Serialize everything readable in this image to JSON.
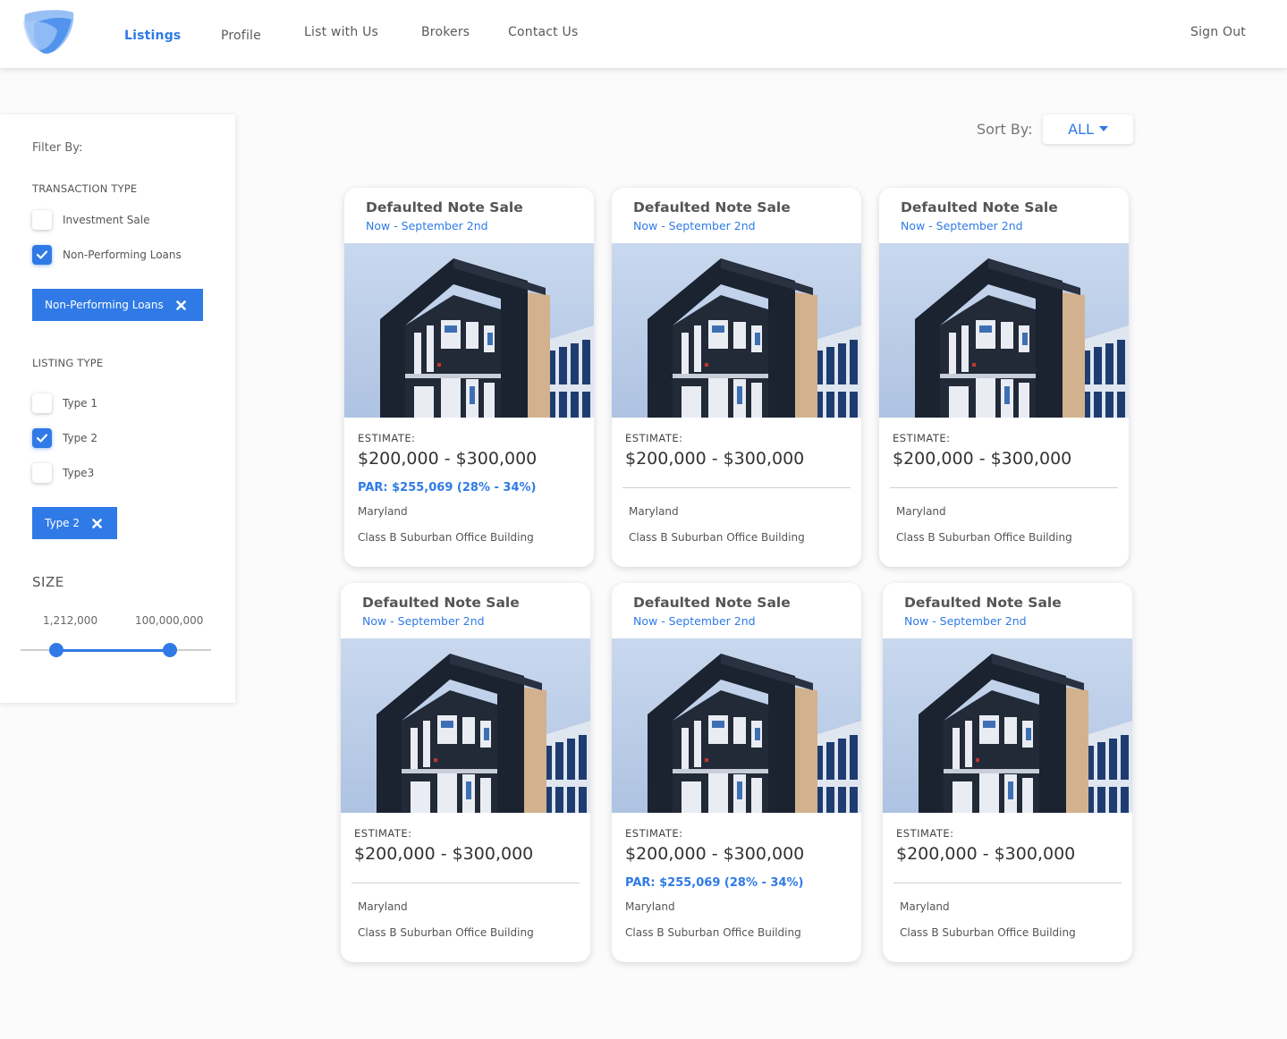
{
  "header": {
    "nav": {
      "listings": "Listings",
      "profile": "Profile",
      "list_with_us": "List with Us",
      "brokers": "Brokers",
      "contact_us": "Contact Us"
    },
    "sign_out": "Sign Out"
  },
  "colors": {
    "accent": "#2f7ae6",
    "text": "#555555"
  },
  "sidebar": {
    "filter_title": "Filter By:",
    "transaction_type": {
      "label": "TRANSACTION TYPE",
      "options": [
        {
          "label": "Investment Sale",
          "checked": false
        },
        {
          "label": "Non-Performing Loans",
          "checked": true
        }
      ],
      "chip": "Non-Performing Loans"
    },
    "listing_type": {
      "label": "LISTING TYPE",
      "options": [
        {
          "label": "Type 1",
          "checked": false
        },
        {
          "label": "Type 2",
          "checked": true
        },
        {
          "label": "Type3",
          "checked": false
        }
      ],
      "chip": "Type 2"
    },
    "size": {
      "label": "SIZE",
      "min": "1,212,000",
      "max": "100,000,000"
    }
  },
  "sort": {
    "label": "Sort By:",
    "value": "ALL"
  },
  "listings": [
    {
      "title": "Defaulted Note Sale",
      "date": "Now - September 2nd",
      "estimate_label": "ESTIMATE:",
      "estimate": "$200,000 - $300,000",
      "par": "PAR: $255,069 (28% - 34%)",
      "location": "Maryland",
      "description": "Class B Suburban Office Building"
    },
    {
      "title": "Defaulted Note Sale",
      "date": "Now - September 2nd",
      "estimate_label": "ESTIMATE:",
      "estimate": "$200,000 - $300,000",
      "par": "",
      "location": "Maryland",
      "description": "Class B Suburban Office Building"
    },
    {
      "title": "Defaulted Note Sale",
      "date": "Now - September 2nd",
      "estimate_label": "ESTIMATE:",
      "estimate": "$200,000 - $300,000",
      "par": "",
      "location": "Maryland",
      "description": "Class B Suburban Office Building"
    },
    {
      "title": "Defaulted Note Sale",
      "date": "Now - September 2nd",
      "estimate_label": "ESTIMATE:",
      "estimate": "$200,000 - $300,000",
      "par": "",
      "location": "Maryland",
      "description": "Class B Suburban Office Building"
    },
    {
      "title": "Defaulted Note Sale",
      "date": "Now - September 2nd",
      "estimate_label": "ESTIMATE:",
      "estimate": "$200,000 - $300,000",
      "par": "PAR: $255,069 (28% - 34%)",
      "location": "Maryland",
      "description": "Class B Suburban Office Building"
    },
    {
      "title": "Defaulted Note Sale",
      "date": "Now - September 2nd",
      "estimate_label": "ESTIMATE:",
      "estimate": "$200,000 - $300,000",
      "par": "",
      "location": "Maryland",
      "description": "Class B Suburban Office Building"
    }
  ]
}
